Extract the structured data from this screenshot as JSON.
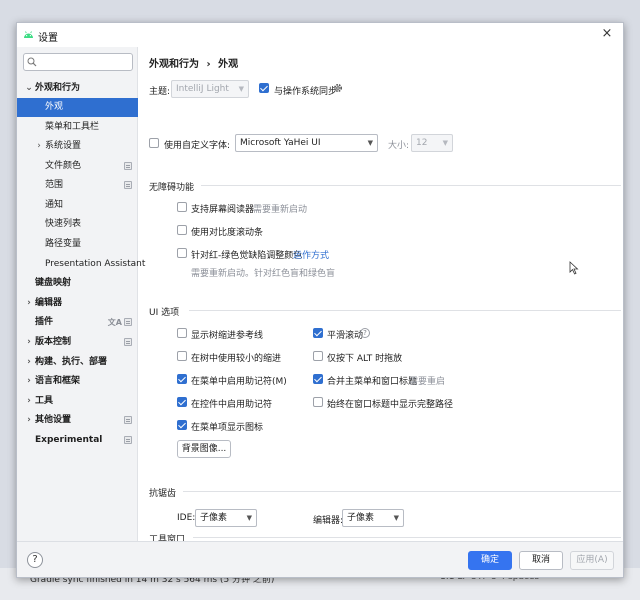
{
  "background": {
    "status_text": "Gradle sync finished in 14 m 32 s 564 ms (5 分钟 之前)",
    "status_right": "1:1  LF  UTF-8  4 spaces"
  },
  "window": {
    "title": "设置",
    "close_label": "×"
  },
  "sidebar": {
    "search_placeholder": "Q",
    "items": [
      {
        "label": "外观和行为",
        "arrow": "⌄"
      },
      {
        "label": "外观"
      },
      {
        "label": "菜单和工具栏"
      },
      {
        "label": "系统设置",
        "arrow": "›"
      },
      {
        "label": "文件颜色"
      },
      {
        "label": "范围"
      },
      {
        "label": "通知"
      },
      {
        "label": "快速列表"
      },
      {
        "label": "路径变量"
      },
      {
        "label": "Presentation Assistant"
      },
      {
        "label": "键盘映射"
      },
      {
        "label": "编辑器",
        "arrow": "›"
      },
      {
        "label": "插件",
        "extra": "文A"
      },
      {
        "label": "版本控制",
        "arrow": "›"
      },
      {
        "label": "构建、执行、部署",
        "arrow": "›"
      },
      {
        "label": "语言和框架",
        "arrow": "›"
      },
      {
        "label": "工具",
        "arrow": "›"
      },
      {
        "label": "其他设置",
        "arrow": "›"
      },
      {
        "label": "Experimental"
      }
    ]
  },
  "breadcrumb": {
    "parent": "外观和行为",
    "separator": "›",
    "current": "外观"
  },
  "theme": {
    "label": "主题:",
    "value": "IntelliJ Light",
    "sync_label": "与操作系统同步",
    "sync_checked": true
  },
  "font": {
    "custom_label": "使用自定义字体:",
    "custom_checked": false,
    "font_value": "Microsoft YaHei UI",
    "size_label": "大小:",
    "size_value": "12"
  },
  "accessibility": {
    "title": "无障碍功能",
    "screen_reader": "支持屏幕阅读器",
    "screen_reader_note": "需要重新启动",
    "contrast_scrollbars": "使用对比度滚动条",
    "color_deficiency": "针对红-绿色觉缺陷调整颜色",
    "how_it_works": "运作方式",
    "color_note": "需要重新启动。针对红色盲和绿色盲"
  },
  "ui_options": {
    "title": "UI 选项",
    "left": [
      {
        "label": "显示树缩进参考线",
        "checked": false
      },
      {
        "label": "在树中使用较小的缩进",
        "checked": false
      },
      {
        "label": "在菜单中启用助记符(M)",
        "checked": true
      },
      {
        "label": "在控件中启用助记符",
        "checked": true
      },
      {
        "label": "在菜单项显示图标",
        "checked": true
      }
    ],
    "right": [
      {
        "label": "平滑滚动",
        "checked": true
      },
      {
        "label": "仅按下 ALT 时拖放",
        "checked": false
      },
      {
        "label": "合并主菜单和窗口标题",
        "checked": true,
        "note": "需要重启"
      },
      {
        "label": "始终在窗口标题中显示完整路径",
        "checked": false
      }
    ],
    "background_image_button": "背景图像..."
  },
  "antialiasing": {
    "title": "抗锯齿",
    "ide_label": "IDE:",
    "ide_value": "子像素",
    "editor_label": "编辑器:",
    "editor_value": "子像素"
  },
  "tool_windows": {
    "title": "工具窗口"
  },
  "footer": {
    "help": "?",
    "ok": "确定",
    "cancel": "取消",
    "apply": "应用(A)"
  },
  "colors": {
    "accent": "#3574f0",
    "selection": "#2f6fd0",
    "link": "#2f6fd0"
  }
}
